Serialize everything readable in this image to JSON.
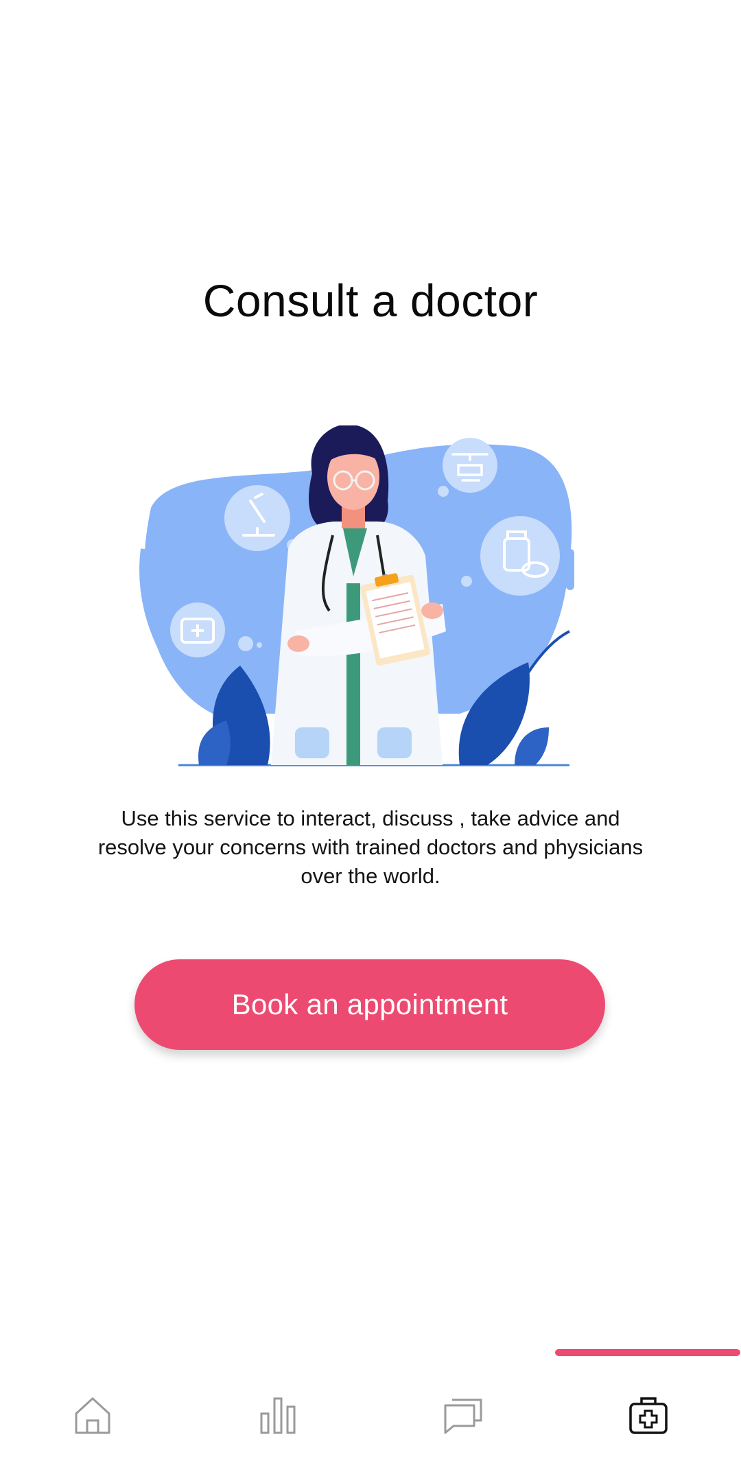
{
  "page": {
    "title": "Consult a doctor",
    "description": "Use this service to interact, discuss , take advice and resolve your concerns with trained doctors and physicians over the world.",
    "cta_label": "Book an appointment"
  },
  "illustration": {
    "subject": "doctor-with-clipboard-illustration",
    "icons": [
      "microscope-icon",
      "helicopter-icon",
      "medicine-bottle-icon",
      "first-aid-kit-icon"
    ]
  },
  "bottom_nav": {
    "items": [
      {
        "id": "home",
        "icon": "home-icon",
        "active": false
      },
      {
        "id": "stats",
        "icon": "bar-chart-icon",
        "active": false
      },
      {
        "id": "chat",
        "icon": "chat-icon",
        "active": false
      },
      {
        "id": "consult",
        "icon": "medical-kit-icon",
        "active": true
      }
    ]
  },
  "colors": {
    "accent": "#ed4a72",
    "blob": "#8ab4f8",
    "leaf": "#1a4fb0",
    "icon_inactive": "#9a9a9a",
    "icon_active": "#111111"
  }
}
